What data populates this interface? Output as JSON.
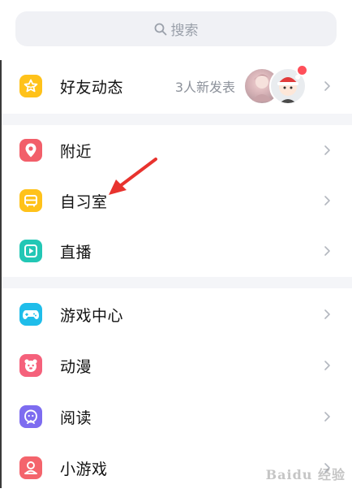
{
  "search": {
    "placeholder": "搜索",
    "icon": "search-icon"
  },
  "friends_feed": {
    "label": "好友动态",
    "status": "3人新发表",
    "icon": "star-icon",
    "icon_color": "#ffc21a",
    "has_new_dot": true
  },
  "group1": [
    {
      "label": "附近",
      "icon": "location-pin-icon",
      "icon_color": "#f25f6a"
    },
    {
      "label": "自习室",
      "icon": "study-room-icon",
      "icon_color": "#ffc21a"
    },
    {
      "label": "直播",
      "icon": "live-icon",
      "icon_color": "#22c7b5"
    }
  ],
  "group2": [
    {
      "label": "游戏中心",
      "icon": "gamepad-icon",
      "icon_color": "#1fbdea"
    },
    {
      "label": "动漫",
      "icon": "anime-icon",
      "icon_color": "#f5617b"
    },
    {
      "label": "阅读",
      "icon": "reading-icon",
      "icon_color": "#7d6cf0"
    },
    {
      "label": "小游戏",
      "icon": "mini-game-icon",
      "icon_color": "#f4646c"
    }
  ],
  "annotation": {
    "arrow_color": "#e8332e"
  },
  "watermark": {
    "text": "Baidu 经验"
  }
}
